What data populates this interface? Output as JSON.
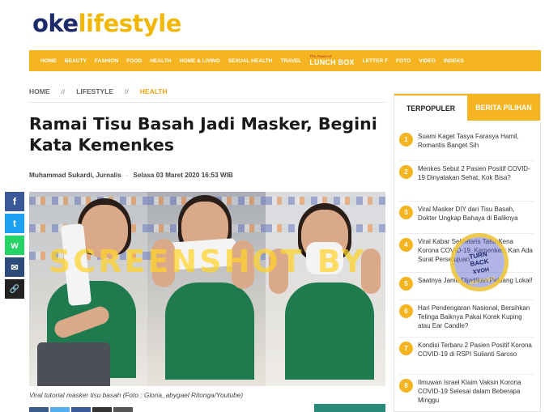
{
  "logo": {
    "part1": "oke",
    "part2": "lifestyle"
  },
  "nav": {
    "items": [
      "HOME",
      "BEAUTY",
      "FASHION",
      "FOOD",
      "HEALTH",
      "HOME & LIVING",
      "SEXUAL HEALTH",
      "TRAVEL"
    ],
    "lunchbox_tag": "The Power of",
    "lunchbox_label": "LUNCH BOX",
    "items_after": [
      "LETTER F",
      "FOTO",
      "VIDEO",
      "INDEKS"
    ]
  },
  "breadcrumb": {
    "home": "HOME",
    "sep": "//",
    "section": "LIFESTYLE",
    "current": "HEALTH"
  },
  "article": {
    "title": "Ramai Tisu Basah Jadi Masker, Begini Kata Kemenkes",
    "author": "Muhammad Sukardi, Jurnalis",
    "dot": "·",
    "date": "Selasa 03 Maret 2020 16:53 WIB",
    "watermark": "SCREENSHOT BY",
    "caption": "Viral tutorial masker tisu basah (Foto : Gloria_abygael Ritonga/Youtube)"
  },
  "share": {
    "fb": "f",
    "tw": "t",
    "wa": "w",
    "mail": "✉",
    "link": "🔗"
  },
  "sidebar": {
    "tab_active": "TERPOPULER",
    "tab_inactive": "BERITA PILIHAN",
    "items": [
      {
        "n": "1",
        "text": "Suami Kaget Tasya Farasya Hamil, Romantis Banget Sih"
      },
      {
        "n": "2",
        "text": "Menkes Sebut 2 Pasien Positif COVID-19 Dinyatakan Sehat, Kok Bisa?"
      },
      {
        "n": "3",
        "text": "Viral Masker DIY dari Tisu Basah, Dokter Ungkap Bahaya di Baliknya"
      },
      {
        "n": "4",
        "text": "Viral Kabar Sekretaris Tahu Kena Korona COVID-19, Kemenkes: Kan Ada Surat Persetujuan"
      },
      {
        "n": "5",
        "text": "Saatnya Jamu Dijadikan Peluang Lokal!"
      },
      {
        "n": "6",
        "text": "Hari Pendengaran Nasional, Bersihkan Telinga Baiknya Pakai Korek Kuping atau Ear Candle?"
      },
      {
        "n": "7",
        "text": "Kondisi Terbaru 2 Pasien Positif Korona COVID-19 di RSPI Sulianti Saroso"
      },
      {
        "n": "8",
        "text": "Ilmuwan Israel Klaim Vaksin Korona COVID-19 Selesai dalam Beberapa Minggu"
      }
    ]
  },
  "stamp": {
    "line1": "TURN",
    "line2": "BACK",
    "line3": "HOAX",
    "ring": "MAFINDO"
  }
}
